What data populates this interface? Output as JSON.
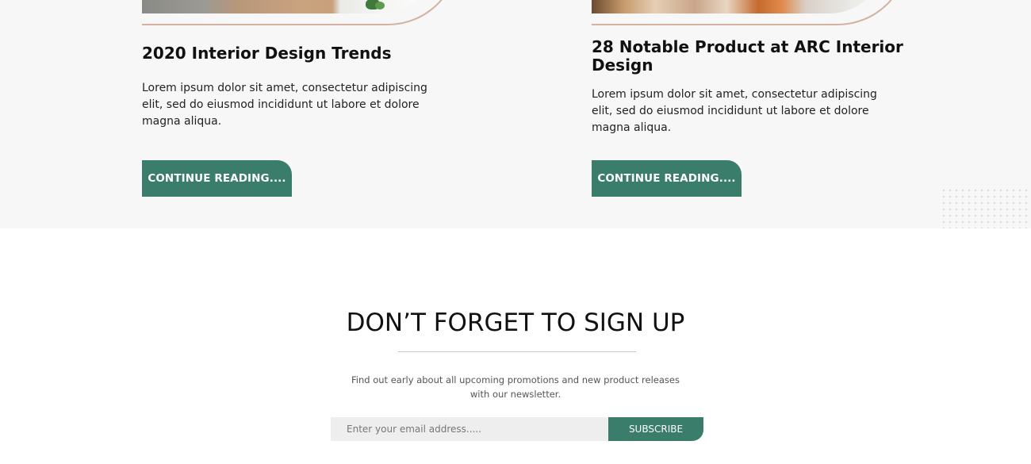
{
  "blog": {
    "posts": [
      {
        "title": "2020 Interior Design Trends",
        "excerpt": "Lorem ipsum dolor sit amet, consectetur adipiscing elit, sed do eiusmod incididunt ut labore et dolore magna aliqua.",
        "button_label": "CONTINUE READING...."
      },
      {
        "title": "28 Notable Product at ARC Interior Design",
        "excerpt": "Lorem ipsum dolor sit amet, consectetur adipiscing elit, sed do eiusmod incididunt ut labore et dolore magna aliqua.",
        "button_label": "CONTINUE READING...."
      }
    ]
  },
  "signup": {
    "title": "DON’T FORGET TO SIGN UP",
    "description": "Find out early about all upcoming promotions and new product releases with our newsletter.",
    "email_placeholder": "Enter your email address.....",
    "button_label": "SUBSCRIBE"
  },
  "colors": {
    "accent": "#3a7d6a",
    "section_bg": "#f7f7f7",
    "arc_outline": "#d3b3a0"
  }
}
